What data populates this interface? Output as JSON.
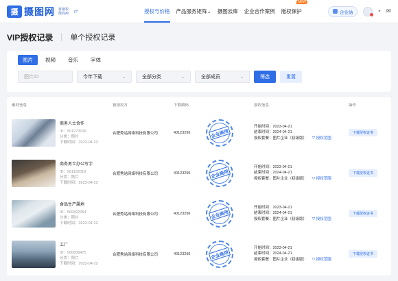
{
  "header": {
    "logo_mark": "摄",
    "logo_name": "摄图网",
    "logo_sub_1": "有版权",
    "logo_sub_2": "敢商用",
    "nav": [
      {
        "label": "授权与价格",
        "active": true,
        "badge": ""
      },
      {
        "label": "产品服务矩阵",
        "active": false,
        "badge": "",
        "caret": "⌄"
      },
      {
        "label": "摄图云库",
        "active": false,
        "badge": ""
      },
      {
        "label": "企业合作案例",
        "active": false,
        "badge": ""
      },
      {
        "label": "版权保护",
        "active": false,
        "badge": "NEW"
      }
    ],
    "site_button": "企业站"
  },
  "title": {
    "main": "VIP授权记录",
    "sub": "单个授权记录"
  },
  "filters": {
    "tabs": [
      "图片",
      "视频",
      "音乐",
      "字体"
    ],
    "active_tab": 0,
    "id_placeholder": "图片ID",
    "select_download": "今年下载",
    "select_category": "全部分类",
    "select_member": "全部成员",
    "filter_button": "筛选",
    "reset_button": "重置"
  },
  "table": {
    "columns": [
      "素材信息",
      "",
      "被授权方",
      "下载编码",
      "",
      "授权信息",
      "操作"
    ],
    "rows": [
      {
        "title": "商务人士合作",
        "id": "ID：501273106",
        "category": "分类：照片",
        "download_time": "下载时间：2023-04-23",
        "licensee": "合肥秀站网络科技有限公司",
        "code": "40123296",
        "stamp": "企业商用",
        "start": "开始时间：2023-04-21",
        "end": "结束时间：2024-04-21",
        "package": "授权套餐：图片企业（初级版）",
        "scope": "授权范围",
        "action": "下载授权证书"
      },
      {
        "title": "商务男士办公写字",
        "id": "ID：501152019",
        "category": "分类：照片",
        "download_time": "下载时间：2023-04-23",
        "licensee": "合肥秀站网络科技有限公司",
        "code": "40123296",
        "stamp": "企业商用",
        "start": "开始时间：2023-04-21",
        "end": "结束时间：2024-04-21",
        "package": "授权套餐：图片企业（初级版）",
        "scope": "授权范围",
        "action": "下载授权证书"
      },
      {
        "title": "食品生产属地",
        "id": "ID：500822054",
        "category": "分类：照片",
        "download_time": "下载时间：2023-04-22",
        "licensee": "合肥秀站网络科技有限公司",
        "code": "40123296",
        "stamp": "企业商用",
        "start": "开始时间：2023-04-21",
        "end": "结束时间：2024-04-21",
        "package": "授权套餐：图片企业（初级版）",
        "scope": "授权范围",
        "action": "下载授权证书"
      },
      {
        "title": "工厂",
        "id": "ID：500839475",
        "category": "分类：照片",
        "download_time": "下载时间：2023-04-22",
        "licensee": "合肥秀站网络科技有限公司",
        "code": "40123296",
        "stamp": "企业商用",
        "start": "开始时间：2023-04-21",
        "end": "结束时间：2024-04-21",
        "package": "授权套餐：图片企业（初级版）",
        "scope": "授权范围",
        "action": "下载授权证书"
      }
    ]
  },
  "icons": {
    "swap": "swap-icon",
    "site": "building-icon",
    "mail": "mail-icon",
    "scope": "shield-icon"
  },
  "colors": {
    "accent": "#2f6ee5",
    "badge": "#ff7a1a"
  }
}
